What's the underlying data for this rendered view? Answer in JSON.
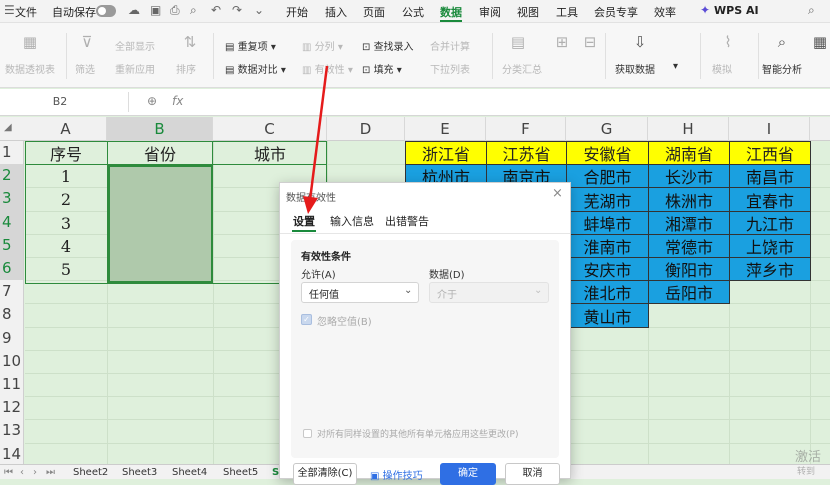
{
  "topbar": {
    "file": "文件",
    "autosave": "自动保存",
    "tabs": [
      "开始",
      "插入",
      "页面",
      "公式",
      "数据",
      "审阅",
      "视图",
      "工具",
      "会员专享",
      "效率"
    ],
    "active_tab": "数据",
    "wps_ai": "WPS AI"
  },
  "ribbon": {
    "pivot": "数据透视表",
    "filter": "筛选",
    "show_all": "全部显示",
    "reapply": "重新应用",
    "sort": "排序",
    "dup": "重复项",
    "compare": "数据对比",
    "split": "分列",
    "valid": "有效性",
    "lookup": "查找录入",
    "fill": "填充",
    "consolidate": "合并计算",
    "dropdown": "下拉列表",
    "subtotal": "分类汇总",
    "get_data": "获取数据",
    "simulate": "模拟",
    "smart": "智能分析"
  },
  "formula_bar": {
    "cell_ref": "B2",
    "fx": "fx"
  },
  "columns": [
    "A",
    "B",
    "C",
    "D",
    "E",
    "F",
    "G",
    "H",
    "I"
  ],
  "rows": [
    "1",
    "2",
    "3",
    "4",
    "5",
    "6",
    "7",
    "8",
    "9",
    "10",
    "11",
    "12",
    "13",
    "14"
  ],
  "table": {
    "headers": [
      "序号",
      "省份",
      "城市"
    ],
    "numbers": [
      "1",
      "2",
      "3",
      "4",
      "5"
    ]
  },
  "provinces": {
    "headers": [
      "浙江省",
      "江苏省",
      "安徽省",
      "湖南省",
      "江西省"
    ],
    "E": [
      "杭州市"
    ],
    "F": [
      "南京市"
    ],
    "G": [
      "合肥市",
      "芜湖市",
      "蚌埠市",
      "淮南市",
      "安庆市",
      "淮北市",
      "黄山市"
    ],
    "H": [
      "长沙市",
      "株洲市",
      "湘潭市",
      "常德市",
      "衡阳市",
      "岳阳市"
    ],
    "I": [
      "南昌市",
      "宜春市",
      "九江市",
      "上饶市",
      "萍乡市"
    ]
  },
  "sheets": [
    "Sheet2",
    "Sheet3",
    "Sheet4",
    "Sheet5",
    "S"
  ],
  "dialog": {
    "title": "数据有效性",
    "tabs": [
      "设置",
      "输入信息",
      "出错警告"
    ],
    "section": "有效性条件",
    "allow_label": "允许(A)",
    "allow_value": "任何值",
    "data_label": "数据(D)",
    "data_value": "介于",
    "ignore_blank": "忽略空值(B)",
    "apply_all": "对所有同样设置的其他所有单元格应用这些更改(P)",
    "clear_all": "全部清除(C)",
    "tips": "操作技巧",
    "ok": "确定",
    "cancel": "取消"
  },
  "watermark": [
    "激活",
    "转到"
  ],
  "colors": {
    "accent": "#1a8a3c",
    "province_fill": "#ffff00",
    "city_fill": "#1aa0e0",
    "ok_button": "#2f6fe4",
    "arrow": "#e51b1b"
  }
}
